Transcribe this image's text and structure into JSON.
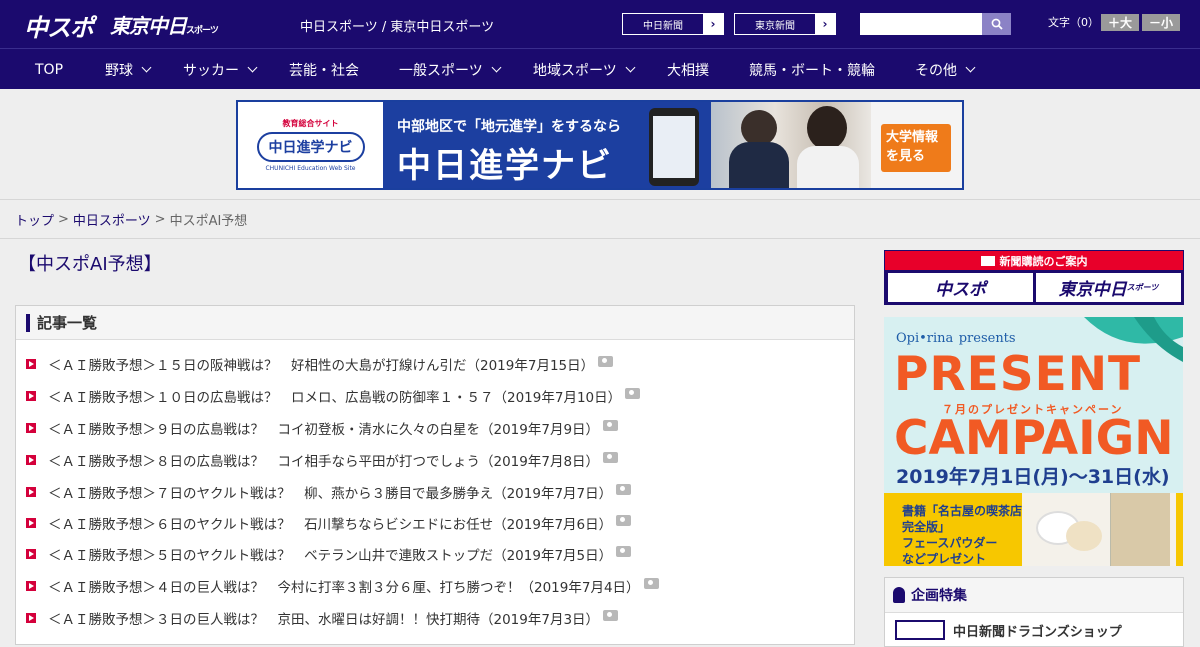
{
  "header": {
    "logo_chuspo": "中スポ",
    "logo_tokyo": "東京中日",
    "logo_tokyo_sub": "スポーツ",
    "site_links": "中日スポーツ / 東京中日スポーツ",
    "buttons": [
      {
        "label": "中日新聞",
        "arrow": "›"
      },
      {
        "label": "東京新聞",
        "arrow": "›"
      }
    ],
    "search": {
      "placeholder": "",
      "icon": "search-icon"
    },
    "font_size": {
      "label": "文字（0）",
      "larger": "＋大",
      "smaller": "－小"
    }
  },
  "nav": {
    "items": [
      {
        "label": "TOP",
        "dropdown": false
      },
      {
        "label": "野球",
        "dropdown": true
      },
      {
        "label": "サッカー",
        "dropdown": true
      },
      {
        "label": "芸能・社会",
        "dropdown": false
      },
      {
        "label": "一般スポーツ",
        "dropdown": true
      },
      {
        "label": "地域スポーツ",
        "dropdown": true
      },
      {
        "label": "大相撲",
        "dropdown": false
      },
      {
        "label": "競馬・ボート・競輪",
        "dropdown": false
      },
      {
        "label": "その他",
        "dropdown": true
      }
    ]
  },
  "banner": {
    "site_tag": "教育総合サイト",
    "logo": "中日進学ナビ",
    "logo_en": "CHUNICHI Education Web Site",
    "headline": "中部地区で「地元進学」をするなら",
    "main": "中日進学ナビ",
    "cta_line1": "大学情報",
    "cta_line2": "を見る"
  },
  "breadcrumb": {
    "items": [
      "トップ",
      "中日スポーツ",
      "中スポAI予想"
    ],
    "separator": ">"
  },
  "page_title": "【中スポAI予想】",
  "article_list": {
    "title": "記事一覧",
    "items": [
      "＜ＡＩ勝敗予想＞１５日の阪神戦は？　好相性の大島が打線けん引だ（2019年7月15日）",
      "＜ＡＩ勝敗予想＞１０日の広島戦は？　ロメロ、広島戦の防御率１・５７（2019年7月10日）",
      "＜ＡＩ勝敗予想＞９日の広島戦は？　コイ初登板・清水に久々の白星を（2019年7月9日）",
      "＜ＡＩ勝敗予想＞８日の広島戦は？　コイ相手なら平田が打つでしょう（2019年7月8日）",
      "＜ＡＩ勝敗予想＞７日のヤクルト戦は？　柳、燕から３勝目で最多勝争え（2019年7月7日）",
      "＜ＡＩ勝敗予想＞６日のヤクルト戦は？　石川撃ちならビシエドにお任せ（2019年7月6日）",
      "＜ＡＩ勝敗予想＞５日のヤクルト戦は？　ベテラン山井で連敗ストップだ（2019年7月5日）",
      "＜ＡＩ勝敗予想＞４日の巨人戦は？　今村に打率３割３分６厘、打ち勝つぞ！（2019年7月4日）",
      "＜ＡＩ勝敗予想＞３日の巨人戦は？　京田、水曜日は好調！！快打期待（2019年7月3日）"
    ]
  },
  "sidebar": {
    "subscribe": {
      "header": "新聞購読のご案内",
      "left": "中スポ",
      "right": "東京中日",
      "right_sub": "スポーツ"
    },
    "campaign": {
      "brand": "Opi•rina",
      "presents": "presents",
      "line1": "PRESENT",
      "sub": "７月のプレゼントキャンペーン",
      "line2": "CAMPAIGN",
      "date": "2019年7月1日(月)〜31日(水)",
      "bottom_line1": "書籍「名古屋の喫茶店",
      "bottom_line2": "完全版」",
      "bottom_line3": "フェースパウダー",
      "bottom_line4": "などプレゼント"
    },
    "kikaku": {
      "title": "企画特集",
      "item": "中日新聞ドラゴンズショップ"
    }
  },
  "colors": {
    "header_bg": "#1b0a6e",
    "accent_red": "#d4003b",
    "campaign_orange": "#f15a24"
  }
}
